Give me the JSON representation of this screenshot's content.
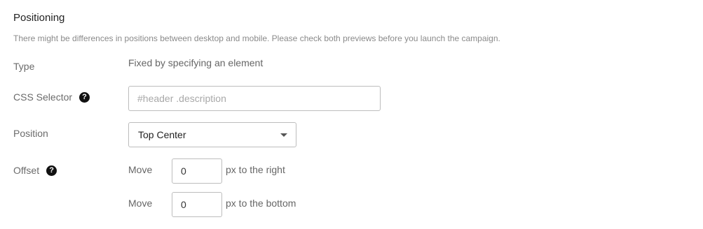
{
  "section": {
    "title": "Positioning",
    "description": "There might be differences in positions between desktop and mobile. Please check both previews before you launch the campaign."
  },
  "type": {
    "label": "Type",
    "value": "Fixed by specifying an element"
  },
  "css_selector": {
    "label": "CSS Selector",
    "help_icon": "?",
    "placeholder": "#header .description",
    "value": ""
  },
  "position": {
    "label": "Position",
    "selected": "Top Center"
  },
  "offset": {
    "label": "Offset",
    "help_icon": "?",
    "rows": [
      {
        "prefix": "Move",
        "value": "0",
        "suffix": "px to the right"
      },
      {
        "prefix": "Move",
        "value": "0",
        "suffix": "px to the bottom"
      }
    ]
  }
}
